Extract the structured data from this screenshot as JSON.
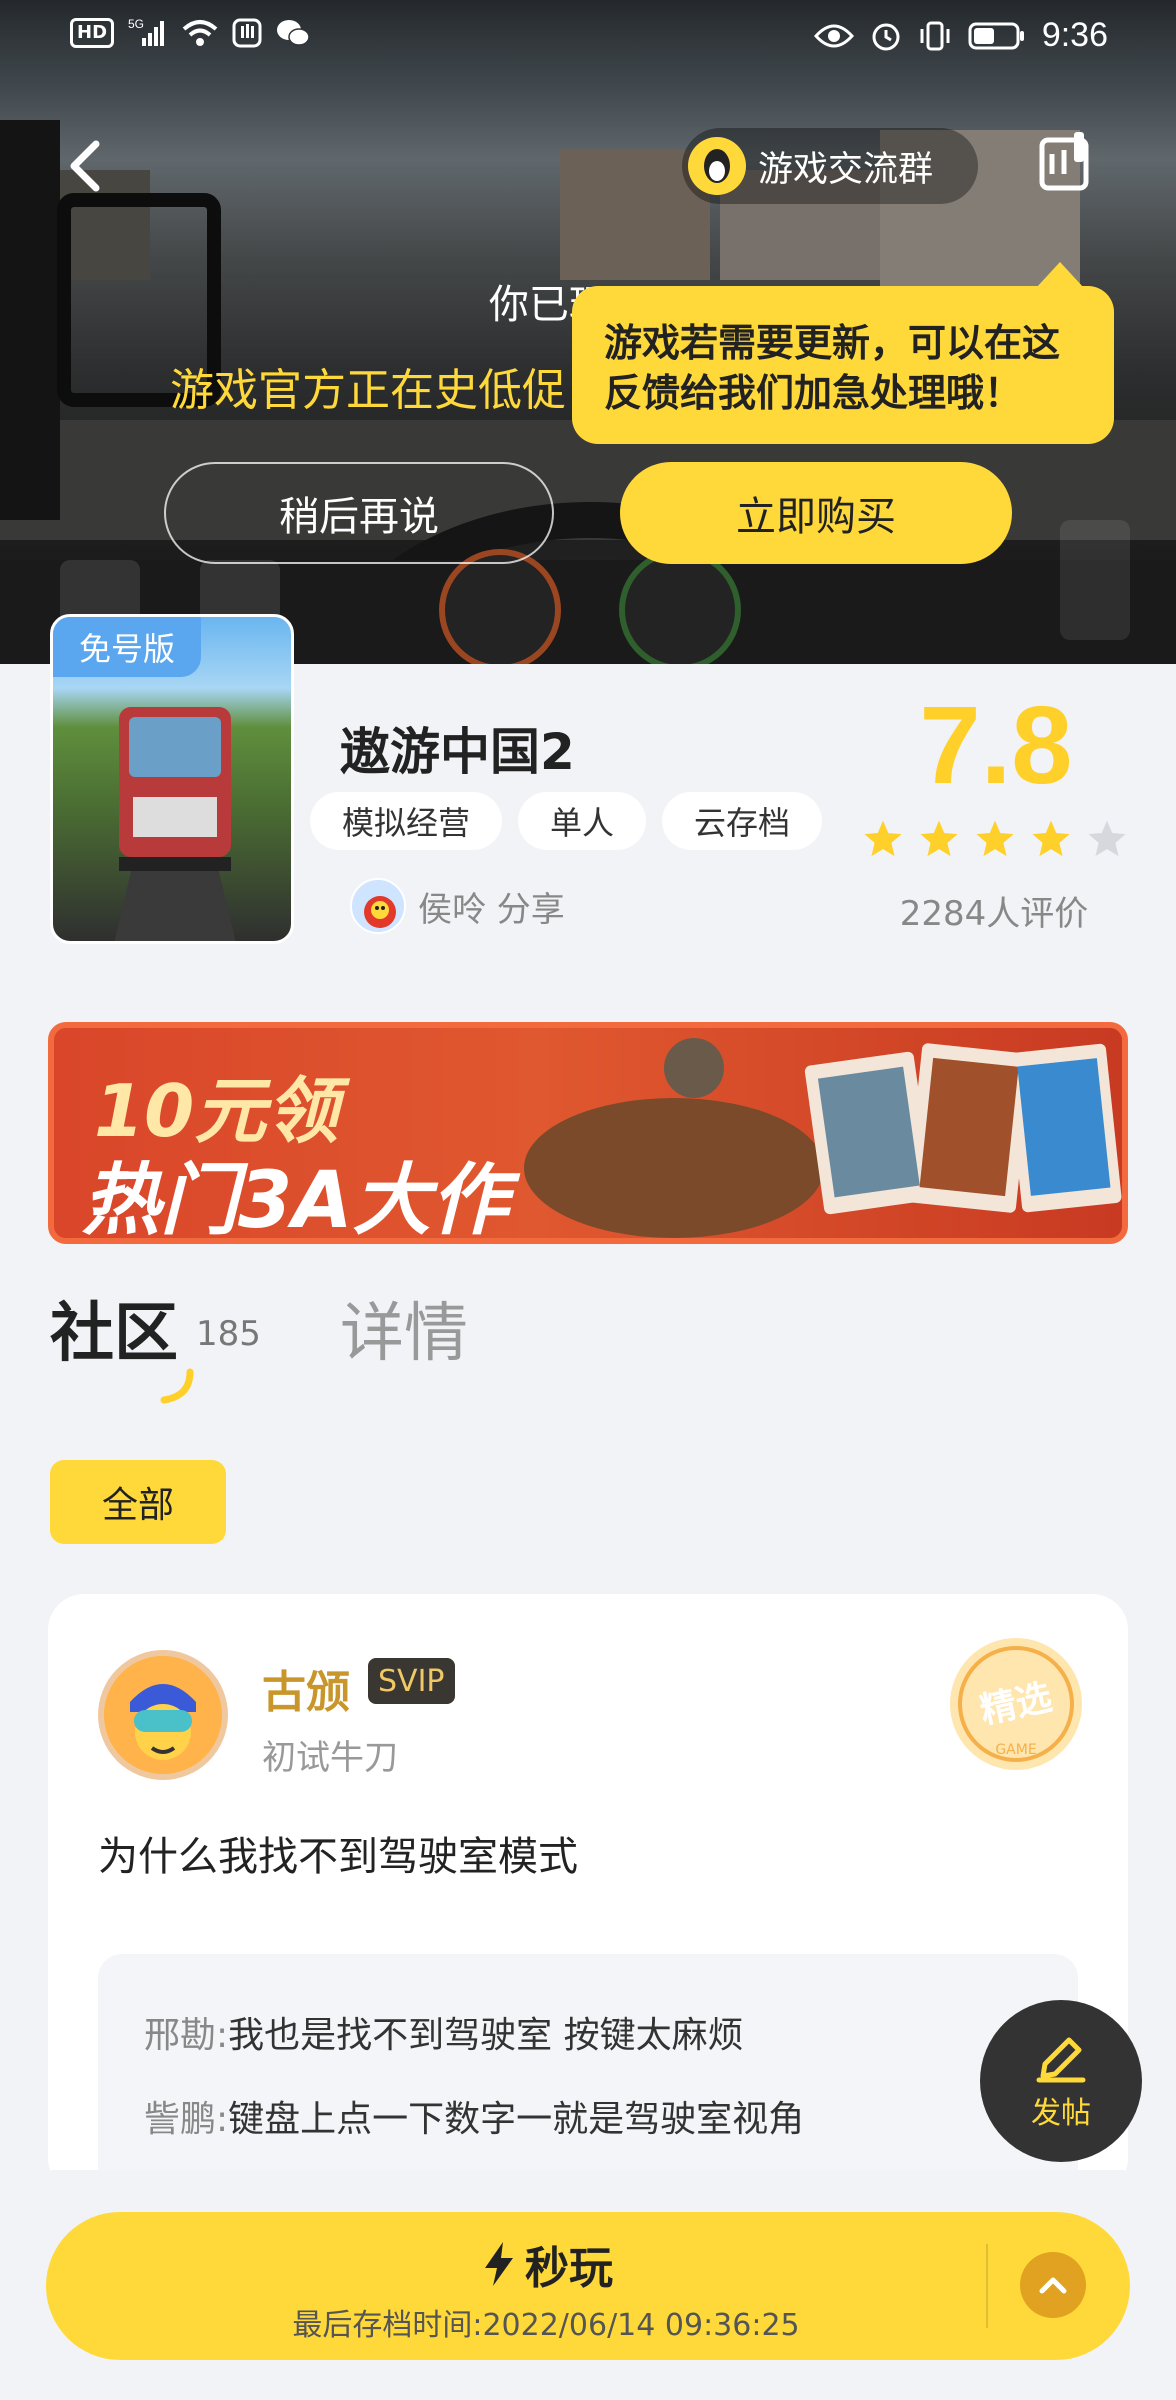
{
  "status_bar": {
    "network": "5G",
    "hd": "HD",
    "time": "9:36"
  },
  "header": {
    "group_label": "游戏交流群"
  },
  "hero": {
    "played_text": "你已玩了...",
    "official_text": "游戏官方正在史低促",
    "tooltip_line1": "游戏若需要更新，可以在这",
    "tooltip_line2": "反馈给我们加急处理哦！",
    "later_label": "稍后再说",
    "buy_label": "立即购买"
  },
  "game": {
    "cover_badge": "免号版",
    "title": "遨游中国2",
    "tags": [
      "模拟经营",
      "单人",
      "云存档"
    ],
    "sharer": "侯呤 分享",
    "score": "7.8",
    "stars": 4,
    "rating_count": "2284人评价"
  },
  "banner": {
    "line1": "10元领",
    "line2": "热门3A大作"
  },
  "tabs": {
    "community": "社区",
    "community_count": "185",
    "detail": "详情"
  },
  "filter": {
    "all": "全部"
  },
  "post": {
    "author": "古颁",
    "badge": "SVIP",
    "level": "初试牛刀",
    "body": "为什么我找不到驾驶室模式",
    "replies": [
      {
        "who": "邢勘:",
        "text": "我也是找不到驾驶室  按键太麻烦"
      },
      {
        "who": "訾鹏:",
        "text": "键盘上点一下数字一就是驾驶室视角"
      }
    ]
  },
  "fab": {
    "label": "发帖"
  },
  "bottom": {
    "play_label": "秒玩",
    "save_time": "最后存档时间:2022/06/14 09:36:25"
  },
  "colors": {
    "accent": "#ffd93a",
    "score": "#ffd02a"
  }
}
